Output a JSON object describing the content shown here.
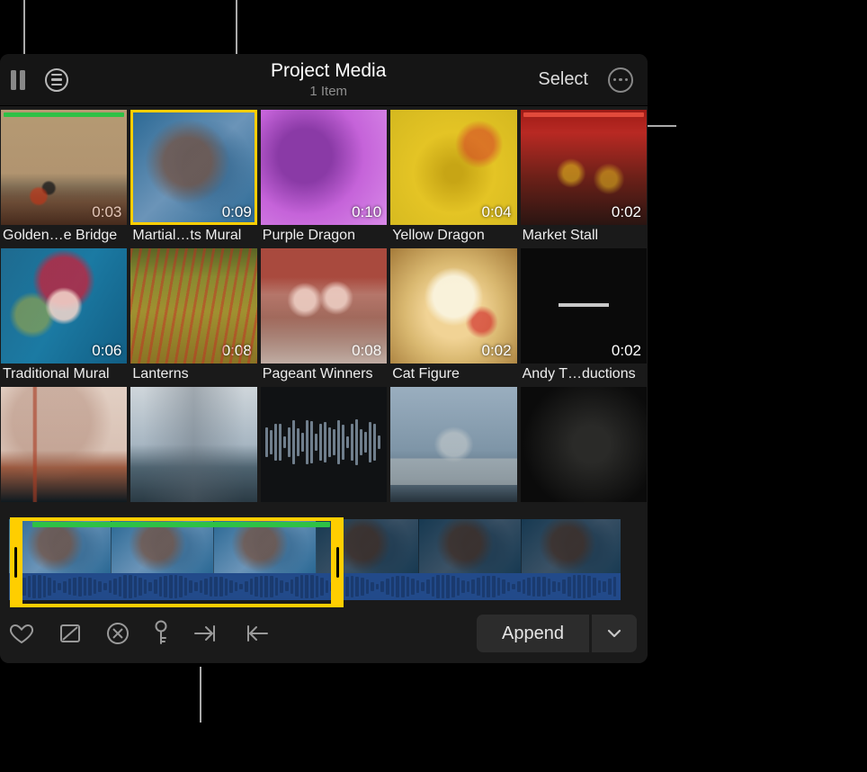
{
  "header": {
    "title": "Project Media",
    "subtitle": "1 Item",
    "select_label": "Select"
  },
  "clips": [
    {
      "name": "Golden…e Bridge",
      "dur": "0:03",
      "thumb": "tn-gg",
      "usage": [
        {
          "color": "#2ec146",
          "left": 0,
          "width": 100
        }
      ]
    },
    {
      "name": "Martial…ts Mural",
      "dur": "0:09",
      "thumb": "tn-mural",
      "selected": true
    },
    {
      "name": "Purple Dragon",
      "dur": "0:10",
      "thumb": "tn-purple"
    },
    {
      "name": "Yellow Dragon",
      "dur": "0:04",
      "thumb": "tn-yellow"
    },
    {
      "name": "Market Stall",
      "dur": "0:02",
      "thumb": "tn-stall",
      "usage": [
        {
          "color": "#e24a3b",
          "left": 0,
          "width": 100
        }
      ]
    },
    {
      "name": "Traditional Mural",
      "dur": "0:06",
      "thumb": "tn-trad"
    },
    {
      "name": "Lanterns",
      "dur": "0:08",
      "thumb": "tn-lanterns"
    },
    {
      "name": "Pageant Winners",
      "dur": "0:08",
      "thumb": "tn-pageant"
    },
    {
      "name": "Cat Figure",
      "dur": "0:02",
      "thumb": "tn-cat"
    },
    {
      "name": "Andy T…ductions",
      "dur": "0:02",
      "thumb": "tn-andy"
    },
    {
      "name": "",
      "dur": "",
      "thumb": "tn-bridge",
      "noname": true
    },
    {
      "name": "",
      "dur": "",
      "thumb": "tn-bay",
      "noname": true
    },
    {
      "name": "",
      "dur": "",
      "thumb": "tn-audio1",
      "audio": true,
      "noname": true
    },
    {
      "name": "",
      "dur": "",
      "thumb": "tn-cityhall",
      "noname": true
    },
    {
      "name": "",
      "dur": "",
      "thumb": "tn-night",
      "noname": true
    }
  ],
  "filmstrip": {
    "selection_start_pct": 1.5,
    "selection_end_pct": 53,
    "greenbar_start_pct": 5,
    "greenbar_end_pct": 51
  },
  "toolbar": {
    "append_label": "Append"
  }
}
